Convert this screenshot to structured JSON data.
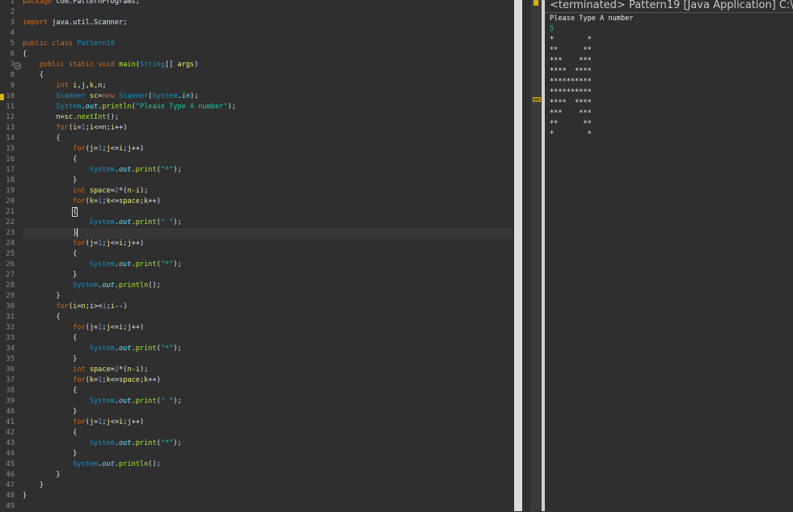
{
  "editor": {
    "line_numbers": [
      "1",
      "2",
      "3",
      "4",
      "5",
      "6",
      "7",
      "8",
      "9",
      "10",
      "11",
      "12",
      "13",
      "14",
      "15",
      "16",
      "17",
      "18",
      "19",
      "20",
      "21",
      "22",
      "23",
      "24",
      "25",
      "26",
      "27",
      "28",
      "29",
      "30",
      "31",
      "32",
      "33",
      "34",
      "35",
      "36",
      "37",
      "38",
      "39",
      "40",
      "41",
      "42",
      "43",
      "44",
      "45",
      "46",
      "47",
      "48",
      "49"
    ],
    "highlighted_line": "23",
    "code_lines": [
      "package com.PatternPrograms;",
      "",
      "import java.util.Scanner;",
      "",
      "public class Pattern19",
      "{",
      "    public static void main(String[] args)",
      "    {",
      "        int i,j,k,n;",
      "        Scanner sc=new Scanner(System.in);",
      "        System.out.println(\"Please Type A number\");",
      "        n=sc.nextInt();",
      "        for(i=1;i<=n;i++)",
      "        {",
      "            for(j=1;j<=i;j++)",
      "            {",
      "                System.out.print(\"*\");",
      "            }",
      "            int space=2*(n-i);",
      "            for(k=1;k<=space;k++)",
      "            {",
      "                System.out.print(\" \");",
      "            }",
      "            for(j=1;j<=i;j++)",
      "            {",
      "                System.out.print(\"*\");",
      "            }",
      "            System.out.println();",
      "        }",
      "        for(i=n;i>=1;i--)",
      "        {",
      "            for(j=1;j<=i;j++)",
      "            {",
      "                System.out.print(\"*\");",
      "            }",
      "            int space=2*(n-i);",
      "            for(k=1;k<=space;k++)",
      "            {",
      "                System.out.print(\" \");",
      "            }",
      "            for(j=1;j<=i;j++)",
      "            {",
      "                System.out.print(\"*\");",
      "            }",
      "            System.out.println();",
      "        }",
      "    }",
      "}",
      ""
    ]
  },
  "console": {
    "title": "<terminated> Pattern19 [Java Application] C:\\",
    "output_lines": [
      {
        "text": "Please Type A number",
        "kind": "output"
      },
      {
        "text": "5",
        "kind": "input"
      },
      {
        "text": "*        *",
        "kind": "output"
      },
      {
        "text": "**      **",
        "kind": "output"
      },
      {
        "text": "***    ***",
        "kind": "output"
      },
      {
        "text": "****  ****",
        "kind": "output"
      },
      {
        "text": "**********",
        "kind": "output"
      },
      {
        "text": "**********",
        "kind": "output"
      },
      {
        "text": "****  ****",
        "kind": "output"
      },
      {
        "text": "***    ***",
        "kind": "output"
      },
      {
        "text": "**      **",
        "kind": "output"
      },
      {
        "text": "*        *",
        "kind": "output"
      }
    ]
  },
  "colors": {
    "background": "#2f2f2f",
    "keyword": "#cc6c1d",
    "class": "#1290c3",
    "string": "#17c6a3",
    "method": "#a7ec21",
    "variable": "#f3ec79",
    "field": "#66e1f8"
  },
  "icons": {
    "collapse": "collapse-minus-icon",
    "warning": "warning-marker-icon"
  }
}
